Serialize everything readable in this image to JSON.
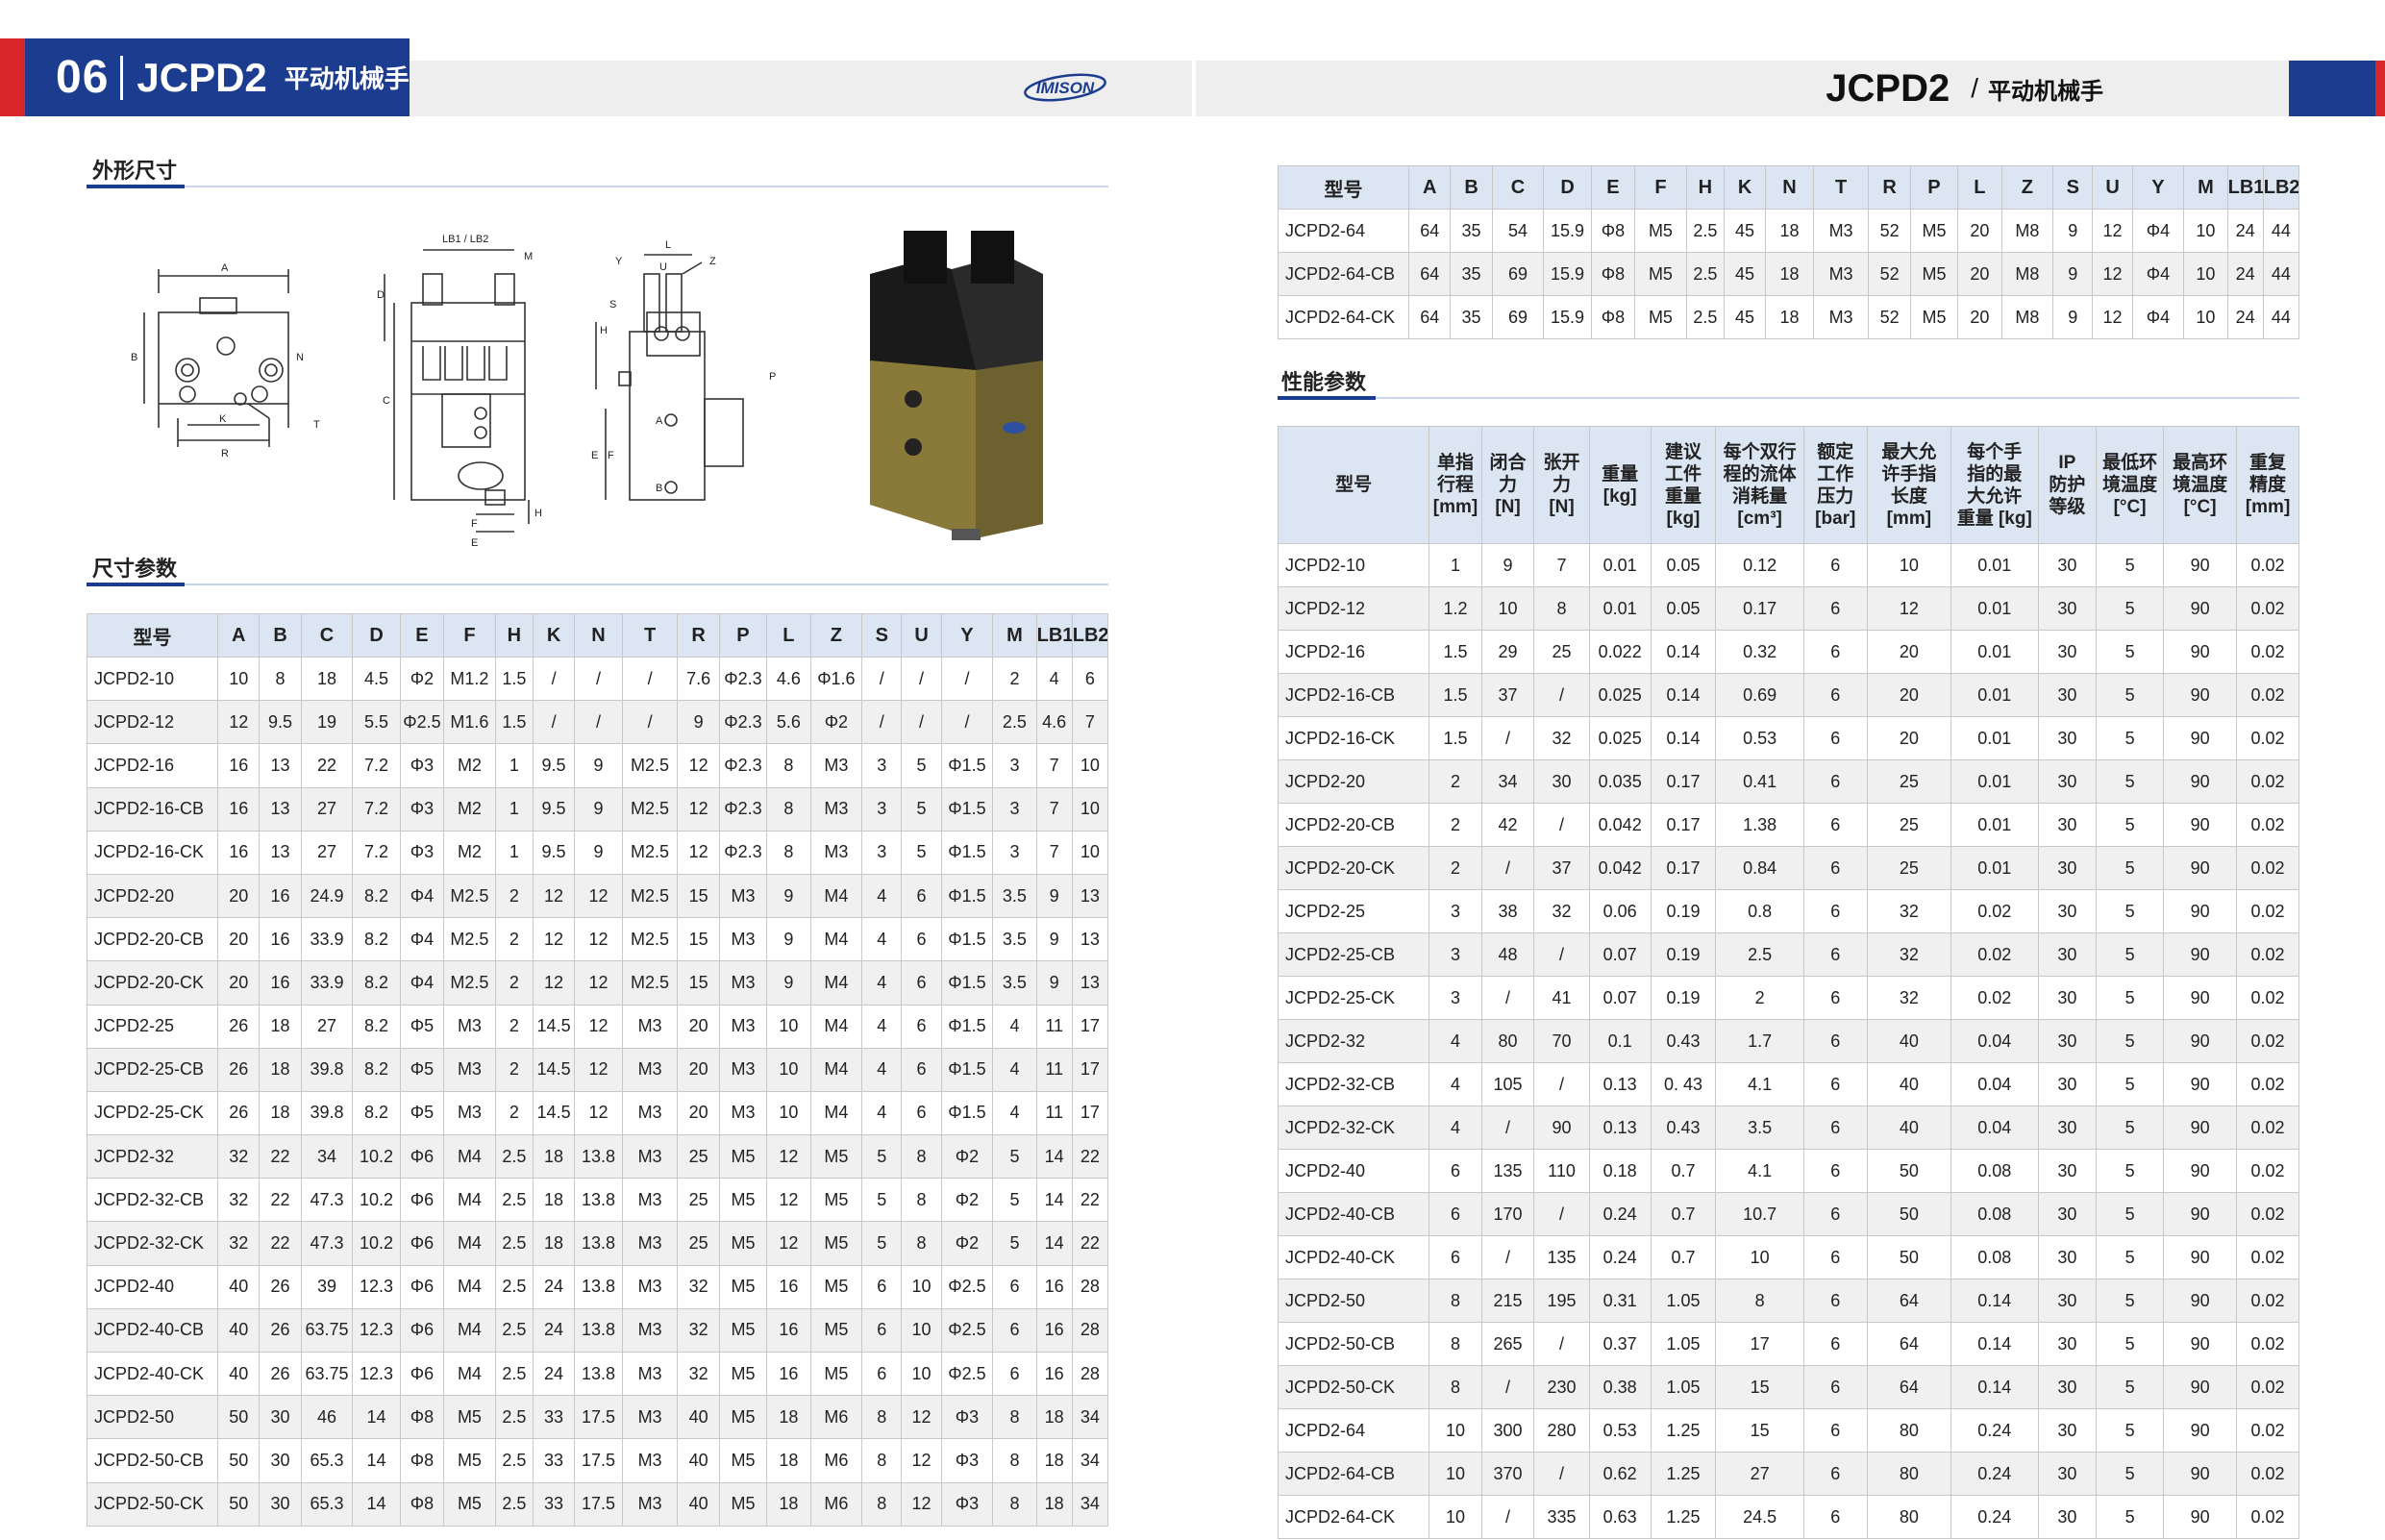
{
  "header": {
    "page_number": "06",
    "model_title": "JCPD2",
    "subtitle": "平动机械手",
    "right_title": "JCPD2",
    "right_sep": "/",
    "right_subtitle": "平动机械手",
    "logo_text": "IMISON"
  },
  "sections": {
    "outline": "外形尺寸",
    "dimensions": "尺寸参数",
    "performance": "性能参数"
  },
  "drawing_labels": {
    "front": [
      "A",
      "B",
      "N",
      "K",
      "R",
      "T"
    ],
    "side": [
      "LB1 / LB2",
      "M",
      "D",
      "C",
      "F",
      "E",
      "H"
    ],
    "end": [
      "L",
      "Y",
      "U",
      "Z",
      "S",
      "H",
      "E",
      "F",
      "P",
      "A",
      "B"
    ]
  },
  "dim_table": {
    "headers": [
      "型号",
      "A",
      "B",
      "C",
      "D",
      "E",
      "F",
      "H",
      "K",
      "N",
      "T",
      "R",
      "P",
      "L",
      "Z",
      "S",
      "U",
      "Y",
      "M",
      "LB1",
      "LB2"
    ],
    "rows": [
      [
        "JCPD2-10",
        "10",
        "8",
        "18",
        "4.5",
        "Φ2",
        "M1.2",
        "1.5",
        "/",
        "/",
        "/",
        "7.6",
        "Φ2.3",
        "4.6",
        "Φ1.6",
        "/",
        "/",
        "/",
        "2",
        "4",
        "6"
      ],
      [
        "JCPD2-12",
        "12",
        "9.5",
        "19",
        "5.5",
        "Φ2.5",
        "M1.6",
        "1.5",
        "/",
        "/",
        "/",
        "9",
        "Φ2.3",
        "5.6",
        "Φ2",
        "/",
        "/",
        "/",
        "2.5",
        "4.6",
        "7"
      ],
      [
        "JCPD2-16",
        "16",
        "13",
        "22",
        "7.2",
        "Φ3",
        "M2",
        "1",
        "9.5",
        "9",
        "M2.5",
        "12",
        "Φ2.3",
        "8",
        "M3",
        "3",
        "5",
        "Φ1.5",
        "3",
        "7",
        "10"
      ],
      [
        "JCPD2-16-CB",
        "16",
        "13",
        "27",
        "7.2",
        "Φ3",
        "M2",
        "1",
        "9.5",
        "9",
        "M2.5",
        "12",
        "Φ2.3",
        "8",
        "M3",
        "3",
        "5",
        "Φ1.5",
        "3",
        "7",
        "10"
      ],
      [
        "JCPD2-16-CK",
        "16",
        "13",
        "27",
        "7.2",
        "Φ3",
        "M2",
        "1",
        "9.5",
        "9",
        "M2.5",
        "12",
        "Φ2.3",
        "8",
        "M3",
        "3",
        "5",
        "Φ1.5",
        "3",
        "7",
        "10"
      ],
      [
        "JCPD2-20",
        "20",
        "16",
        "24.9",
        "8.2",
        "Φ4",
        "M2.5",
        "2",
        "12",
        "12",
        "M2.5",
        "15",
        "M3",
        "9",
        "M4",
        "4",
        "6",
        "Φ1.5",
        "3.5",
        "9",
        "13"
      ],
      [
        "JCPD2-20-CB",
        "20",
        "16",
        "33.9",
        "8.2",
        "Φ4",
        "M2.5",
        "2",
        "12",
        "12",
        "M2.5",
        "15",
        "M3",
        "9",
        "M4",
        "4",
        "6",
        "Φ1.5",
        "3.5",
        "9",
        "13"
      ],
      [
        "JCPD2-20-CK",
        "20",
        "16",
        "33.9",
        "8.2",
        "Φ4",
        "M2.5",
        "2",
        "12",
        "12",
        "M2.5",
        "15",
        "M3",
        "9",
        "M4",
        "4",
        "6",
        "Φ1.5",
        "3.5",
        "9",
        "13"
      ],
      [
        "JCPD2-25",
        "26",
        "18",
        "27",
        "8.2",
        "Φ5",
        "M3",
        "2",
        "14.5",
        "12",
        "M3",
        "20",
        "M3",
        "10",
        "M4",
        "4",
        "6",
        "Φ1.5",
        "4",
        "11",
        "17"
      ],
      [
        "JCPD2-25-CB",
        "26",
        "18",
        "39.8",
        "8.2",
        "Φ5",
        "M3",
        "2",
        "14.5",
        "12",
        "M3",
        "20",
        "M3",
        "10",
        "M4",
        "4",
        "6",
        "Φ1.5",
        "4",
        "11",
        "17"
      ],
      [
        "JCPD2-25-CK",
        "26",
        "18",
        "39.8",
        "8.2",
        "Φ5",
        "M3",
        "2",
        "14.5",
        "12",
        "M3",
        "20",
        "M3",
        "10",
        "M4",
        "4",
        "6",
        "Φ1.5",
        "4",
        "11",
        "17"
      ],
      [
        "JCPD2-32",
        "32",
        "22",
        "34",
        "10.2",
        "Φ6",
        "M4",
        "2.5",
        "18",
        "13.8",
        "M3",
        "25",
        "M5",
        "12",
        "M5",
        "5",
        "8",
        "Φ2",
        "5",
        "14",
        "22"
      ],
      [
        "JCPD2-32-CB",
        "32",
        "22",
        "47.3",
        "10.2",
        "Φ6",
        "M4",
        "2.5",
        "18",
        "13.8",
        "M3",
        "25",
        "M5",
        "12",
        "M5",
        "5",
        "8",
        "Φ2",
        "5",
        "14",
        "22"
      ],
      [
        "JCPD2-32-CK",
        "32",
        "22",
        "47.3",
        "10.2",
        "Φ6",
        "M4",
        "2.5",
        "18",
        "13.8",
        "M3",
        "25",
        "M5",
        "12",
        "M5",
        "5",
        "8",
        "Φ2",
        "5",
        "14",
        "22"
      ],
      [
        "JCPD2-40",
        "40",
        "26",
        "39",
        "12.3",
        "Φ6",
        "M4",
        "2.5",
        "24",
        "13.8",
        "M3",
        "32",
        "M5",
        "16",
        "M5",
        "6",
        "10",
        "Φ2.5",
        "6",
        "16",
        "28"
      ],
      [
        "JCPD2-40-CB",
        "40",
        "26",
        "63.75",
        "12.3",
        "Φ6",
        "M4",
        "2.5",
        "24",
        "13.8",
        "M3",
        "32",
        "M5",
        "16",
        "M5",
        "6",
        "10",
        "Φ2.5",
        "6",
        "16",
        "28"
      ],
      [
        "JCPD2-40-CK",
        "40",
        "26",
        "63.75",
        "12.3",
        "Φ6",
        "M4",
        "2.5",
        "24",
        "13.8",
        "M3",
        "32",
        "M5",
        "16",
        "M5",
        "6",
        "10",
        "Φ2.5",
        "6",
        "16",
        "28"
      ],
      [
        "JCPD2-50",
        "50",
        "30",
        "46",
        "14",
        "Φ8",
        "M5",
        "2.5",
        "33",
        "17.5",
        "M3",
        "40",
        "M5",
        "18",
        "M6",
        "8",
        "12",
        "Φ3",
        "8",
        "18",
        "34"
      ],
      [
        "JCPD2-50-CB",
        "50",
        "30",
        "65.3",
        "14",
        "Φ8",
        "M5",
        "2.5",
        "33",
        "17.5",
        "M3",
        "40",
        "M5",
        "18",
        "M6",
        "8",
        "12",
        "Φ3",
        "8",
        "18",
        "34"
      ],
      [
        "JCPD2-50-CK",
        "50",
        "30",
        "65.3",
        "14",
        "Φ8",
        "M5",
        "2.5",
        "33",
        "17.5",
        "M3",
        "40",
        "M5",
        "18",
        "M6",
        "8",
        "12",
        "Φ3",
        "8",
        "18",
        "34"
      ]
    ]
  },
  "dim64_table": {
    "headers": [
      "型号",
      "A",
      "B",
      "C",
      "D",
      "E",
      "F",
      "H",
      "K",
      "N",
      "T",
      "R",
      "P",
      "L",
      "Z",
      "S",
      "U",
      "Y",
      "M",
      "LB1",
      "LB2"
    ],
    "rows": [
      [
        "JCPD2-64",
        "64",
        "35",
        "54",
        "15.9",
        "Φ8",
        "M5",
        "2.5",
        "45",
        "18",
        "M3",
        "52",
        "M5",
        "20",
        "M8",
        "9",
        "12",
        "Φ4",
        "10",
        "24",
        "44"
      ],
      [
        "JCPD2-64-CB",
        "64",
        "35",
        "69",
        "15.9",
        "Φ8",
        "M5",
        "2.5",
        "45",
        "18",
        "M3",
        "52",
        "M5",
        "20",
        "M8",
        "9",
        "12",
        "Φ4",
        "10",
        "24",
        "44"
      ],
      [
        "JCPD2-64-CK",
        "64",
        "35",
        "69",
        "15.9",
        "Φ8",
        "M5",
        "2.5",
        "45",
        "18",
        "M3",
        "52",
        "M5",
        "20",
        "M8",
        "9",
        "12",
        "Φ4",
        "10",
        "24",
        "44"
      ]
    ]
  },
  "perf_table": {
    "headers": [
      "型号",
      "单指\n行程\n[mm]",
      "闭合\n力\n[N]",
      "张开\n力\n[N]",
      "重量\n[kg]",
      "建议\n工件\n重量\n[kg]",
      "每个双行\n程的流体\n消耗量\n[cm³]",
      "额定\n工作\n压力\n[bar]",
      "最大允\n许手指\n长度\n[mm]",
      "每个手\n指的最\n大允许\n重量 [kg]",
      "IP\n防护\n等级",
      "最低环\n境温度\n[°C]",
      "最高环\n境温度\n[°C]",
      "重复\n精度\n[mm]"
    ],
    "rows": [
      [
        "JCPD2-10",
        "1",
        "9",
        "7",
        "0.01",
        "0.05",
        "0.12",
        "6",
        "10",
        "0.01",
        "30",
        "5",
        "90",
        "0.02"
      ],
      [
        "JCPD2-12",
        "1.2",
        "10",
        "8",
        "0.01",
        "0.05",
        "0.17",
        "6",
        "12",
        "0.01",
        "30",
        "5",
        "90",
        "0.02"
      ],
      [
        "JCPD2-16",
        "1.5",
        "29",
        "25",
        "0.022",
        "0.14",
        "0.32",
        "6",
        "20",
        "0.01",
        "30",
        "5",
        "90",
        "0.02"
      ],
      [
        "JCPD2-16-CB",
        "1.5",
        "37",
        "/",
        "0.025",
        "0.14",
        "0.69",
        "6",
        "20",
        "0.01",
        "30",
        "5",
        "90",
        "0.02"
      ],
      [
        "JCPD2-16-CK",
        "1.5",
        "/",
        "32",
        "0.025",
        "0.14",
        "0.53",
        "6",
        "20",
        "0.01",
        "30",
        "5",
        "90",
        "0.02"
      ],
      [
        "JCPD2-20",
        "2",
        "34",
        "30",
        "0.035",
        "0.17",
        "0.41",
        "6",
        "25",
        "0.01",
        "30",
        "5",
        "90",
        "0.02"
      ],
      [
        "JCPD2-20-CB",
        "2",
        "42",
        "/",
        "0.042",
        "0.17",
        "1.38",
        "6",
        "25",
        "0.01",
        "30",
        "5",
        "90",
        "0.02"
      ],
      [
        "JCPD2-20-CK",
        "2",
        "/",
        "37",
        "0.042",
        "0.17",
        "0.84",
        "6",
        "25",
        "0.01",
        "30",
        "5",
        "90",
        "0.02"
      ],
      [
        "JCPD2-25",
        "3",
        "38",
        "32",
        "0.06",
        "0.19",
        "0.8",
        "6",
        "32",
        "0.02",
        "30",
        "5",
        "90",
        "0.02"
      ],
      [
        "JCPD2-25-CB",
        "3",
        "48",
        "/",
        "0.07",
        "0.19",
        "2.5",
        "6",
        "32",
        "0.02",
        "30",
        "5",
        "90",
        "0.02"
      ],
      [
        "JCPD2-25-CK",
        "3",
        "/",
        "41",
        "0.07",
        "0.19",
        "2",
        "6",
        "32",
        "0.02",
        "30",
        "5",
        "90",
        "0.02"
      ],
      [
        "JCPD2-32",
        "4",
        "80",
        "70",
        "0.1",
        "0.43",
        "1.7",
        "6",
        "40",
        "0.04",
        "30",
        "5",
        "90",
        "0.02"
      ],
      [
        "JCPD2-32-CB",
        "4",
        "105",
        "/",
        "0.13",
        "0. 43",
        "4.1",
        "6",
        "40",
        "0.04",
        "30",
        "5",
        "90",
        "0.02"
      ],
      [
        "JCPD2-32-CK",
        "4",
        "/",
        "90",
        "0.13",
        "0.43",
        "3.5",
        "6",
        "40",
        "0.04",
        "30",
        "5",
        "90",
        "0.02"
      ],
      [
        "JCPD2-40",
        "6",
        "135",
        "110",
        "0.18",
        "0.7",
        "4.1",
        "6",
        "50",
        "0.08",
        "30",
        "5",
        "90",
        "0.02"
      ],
      [
        "JCPD2-40-CB",
        "6",
        "170",
        "/",
        "0.24",
        "0.7",
        "10.7",
        "6",
        "50",
        "0.08",
        "30",
        "5",
        "90",
        "0.02"
      ],
      [
        "JCPD2-40-CK",
        "6",
        "/",
        "135",
        "0.24",
        "0.7",
        "10",
        "6",
        "50",
        "0.08",
        "30",
        "5",
        "90",
        "0.02"
      ],
      [
        "JCPD2-50",
        "8",
        "215",
        "195",
        "0.31",
        "1.05",
        "8",
        "6",
        "64",
        "0.14",
        "30",
        "5",
        "90",
        "0.02"
      ],
      [
        "JCPD2-50-CB",
        "8",
        "265",
        "/",
        "0.37",
        "1.05",
        "17",
        "6",
        "64",
        "0.14",
        "30",
        "5",
        "90",
        "0.02"
      ],
      [
        "JCPD2-50-CK",
        "8",
        "/",
        "230",
        "0.38",
        "1.05",
        "15",
        "6",
        "64",
        "0.14",
        "30",
        "5",
        "90",
        "0.02"
      ],
      [
        "JCPD2-64",
        "10",
        "300",
        "280",
        "0.53",
        "1.25",
        "15",
        "6",
        "80",
        "0.24",
        "30",
        "5",
        "90",
        "0.02"
      ],
      [
        "JCPD2-64-CB",
        "10",
        "370",
        "/",
        "0.62",
        "1.25",
        "27",
        "6",
        "80",
        "0.24",
        "30",
        "5",
        "90",
        "0.02"
      ],
      [
        "JCPD2-64-CK",
        "10",
        "/",
        "335",
        "0.63",
        "1.25",
        "24.5",
        "6",
        "80",
        "0.24",
        "30",
        "5",
        "90",
        "0.02"
      ]
    ]
  },
  "colors": {
    "brand_blue": "#1c3d8f",
    "brand_red": "#d9262a",
    "header_cell": "#dce6f3",
    "alt_row": "#f0f0f0"
  }
}
